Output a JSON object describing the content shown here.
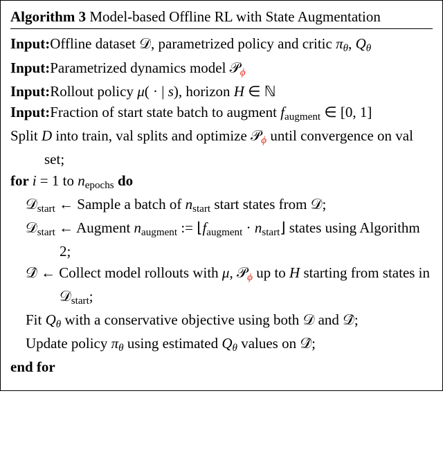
{
  "header": {
    "label": "Algorithm 3",
    "title": "Model-based Offline RL with State Augmentation"
  },
  "lines": {
    "in1_kw": "Input:",
    "in1_txt_a": "Offline dataset ",
    "in1_sym_D": "𝒟",
    "in1_txt_b": ", parametrized policy and critic ",
    "in1_sym_pi": "π",
    "in1_sub_theta1": "θ",
    "in1_comma": ", ",
    "in1_sym_Q": "Q",
    "in1_sub_theta2": "θ",
    "in2_kw": "Input:",
    "in2_txt": "Parametrized dynamics model ",
    "in2_sym_P": "𝒫",
    "in2_sub_phi": "ϕ",
    "in3_kw": "Input:",
    "in3_txt_a": "Rollout policy ",
    "in3_mu": "μ",
    "in3_txt_b": "( · | ",
    "in3_s": "s",
    "in3_txt_c": "), horizon ",
    "in3_H": "H",
    "in3_in": " ∈ ",
    "in3_N": "ℕ",
    "in4_kw": "Input:",
    "in4_txt_a": "Fraction of start state batch to augment ",
    "in4_f": "f",
    "in4_aug": "augment",
    "in4_txt_b": " ∈ [0, 1]",
    "l5_a": "Split ",
    "l5_D": "D",
    "l5_b": " into train, val splits and optimize ",
    "l5_P": "𝒫",
    "l5_phi": "ϕ",
    "l5_c": " until convergence on val set;",
    "for_kw": "for ",
    "for_i": "i",
    "for_eq": " = 1 to ",
    "for_n": "n",
    "for_ep": "epochs",
    "for_do": " do",
    "b1_D": "𝒟",
    "b1_start": "start",
    "b1_arrow": " ← Sample a batch of ",
    "b1_n": "n",
    "b1_txt": " start states from ",
    "b1_D2": "𝒟",
    "b1_semi": ";",
    "b2_D": "𝒟",
    "b2_start": "start",
    "b2_arrow": " ← Augment ",
    "b2_n": "n",
    "b2_aug": "augment",
    "b2_def": " := ⌊",
    "b2_f": "f",
    "b2_dot": " · ",
    "b2_n2": "n",
    "b2_start2": "start",
    "b2_rf": "⌋ states using Algorithm 2;",
    "b3_Dh": "𝒟̂",
    "b3_arrow": " ← Collect model rollouts with ",
    "b3_mu": "μ",
    "b3_comma": ", ",
    "b3_P": "𝒫",
    "b3_phi": "ϕ",
    "b3_txt_a": " up to ",
    "b3_H": "H",
    "b3_txt_b": " starting from states in ",
    "b3_D": "𝒟",
    "b3_start": "start",
    "b3_semi": ";",
    "b4_a": "Fit ",
    "b4_Q": "Q",
    "b4_th": "θ",
    "b4_b": " with a conservative objective using both ",
    "b4_D": "𝒟",
    "b4_and": " and ",
    "b4_Dh": "𝒟̂",
    "b4_semi": ";",
    "b5_a": "Update policy ",
    "b5_pi": "π",
    "b5_th": "θ",
    "b5_b": " using estimated ",
    "b5_Q": "Q",
    "b5_th2": "θ",
    "b5_c": " values on ",
    "b5_Dh": "𝒟̂",
    "b5_semi": ";",
    "endfor": "end for"
  },
  "chart_data": {
    "type": "table",
    "title": "Algorithm 3: Model-based Offline RL with State Augmentation",
    "inputs": [
      "Offline dataset D, parametrized policy and critic π_θ, Q_θ",
      "Parametrized dynamics model P_ϕ",
      "Rollout policy μ(· | s), horizon H ∈ ℕ",
      "Fraction of start state batch to augment f_augment ∈ [0, 1]"
    ],
    "steps": [
      "Split D into train, val splits and optimize P_ϕ until convergence on val set;",
      "for i = 1 to n_epochs do",
      "  D_start ← Sample a batch of n_start start states from D;",
      "  D_start ← Augment n_augment := ⌊f_augment · n_start⌋ states using Algorithm 2;",
      "  D̂ ← Collect model rollouts with μ, P_ϕ up to H starting from states in D_start;",
      "  Fit Q_θ with a conservative objective using both D and D̂;",
      "  Update policy π_θ using estimated Q_θ values on D̂;",
      "end for"
    ]
  }
}
